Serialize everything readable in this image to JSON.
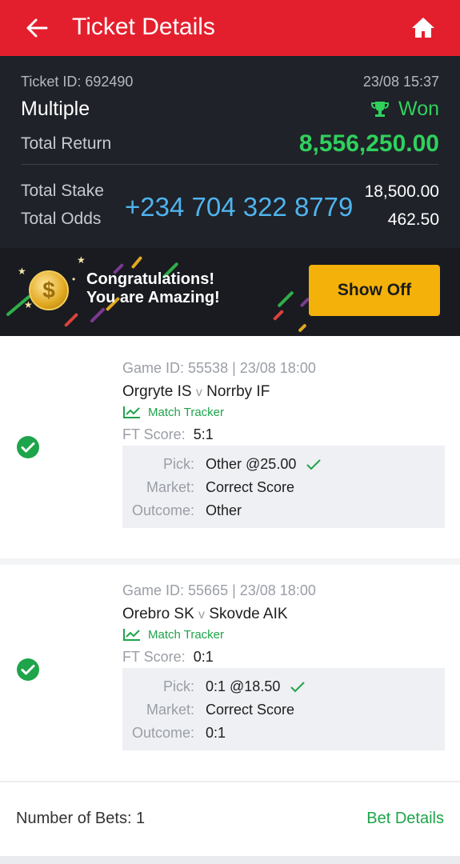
{
  "header": {
    "title": "Ticket Details",
    "back_icon": "arrow-left-icon",
    "home_icon": "home-icon",
    "bg_color": "#e41f2d"
  },
  "summary": {
    "ticket_id": "Ticket ID: 692490",
    "date": "23/08 15:37",
    "bet_type": "Multiple",
    "status": "Won",
    "status_icon": "trophy-icon",
    "total_return_label": "Total Return",
    "total_return": "8,556,250.00",
    "total_stake_label": "Total Stake",
    "total_stake": "18,500.00",
    "total_odds_label": "Total Odds",
    "total_odds": "462.50",
    "overlay_phone": "+234 704 322 8779",
    "accent_green": "#2fd15c",
    "phone_color": "#4fb4ee"
  },
  "banner": {
    "line1": "Congratulations!",
    "line2": "You are Amazing!",
    "button": "Show Off",
    "coin_icon": "coin-icon",
    "button_color": "#f4b10a"
  },
  "bets": [
    {
      "game_id": "Game ID: 55538 | 23/08 18:00",
      "home": "Orgryte IS",
      "vs": "v",
      "away": "Norrby IF",
      "tracker": "Match Tracker",
      "ft_label": "FT Score:",
      "ft_score": "5:1",
      "pick_label": "Pick:",
      "pick": "Other @25.00",
      "market_label": "Market:",
      "market": "Correct Score",
      "outcome_label": "Outcome:",
      "outcome": "Other"
    },
    {
      "game_id": "Game ID: 55665 | 23/08 18:00",
      "home": "Orebro SK",
      "vs": "v",
      "away": "Skovde AIK",
      "tracker": "Match Tracker",
      "ft_label": "FT Score:",
      "ft_score": "0:1",
      "pick_label": "Pick:",
      "pick": "0:1 @18.50",
      "market_label": "Market:",
      "market": "Correct Score",
      "outcome_label": "Outcome:",
      "outcome": "0:1"
    }
  ],
  "footer": {
    "number_of_bets": "Number of Bets: 1",
    "bet_details": "Bet Details"
  }
}
